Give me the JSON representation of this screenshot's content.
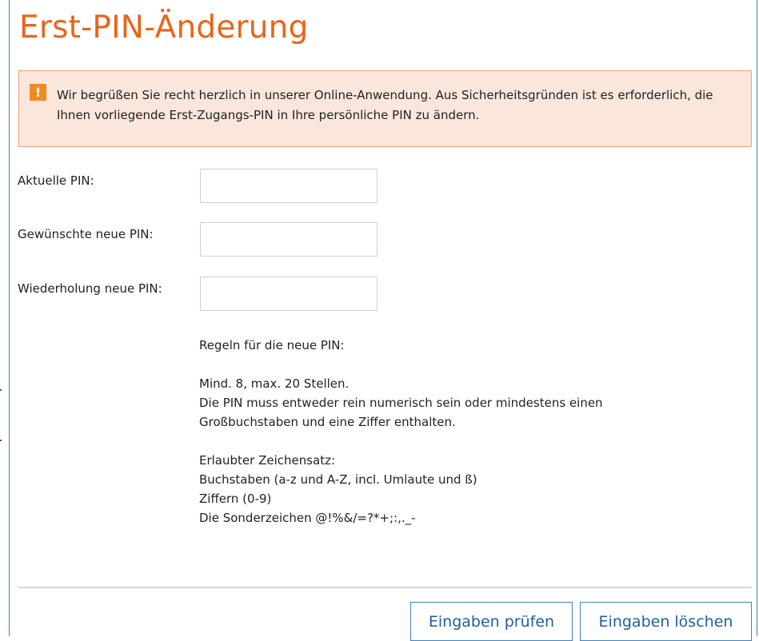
{
  "page": {
    "title": "Erst-PIN-Änderung"
  },
  "alert": {
    "icon": "exclamation-icon",
    "icon_glyph": "!",
    "text": "Wir begrüßen Sie recht herzlich in unserer Online-Anwendung. Aus Sicherheitsgründen ist es erforderlich, die Ihnen vorliegende Erst-Zugangs-PIN in Ihre persönliche PIN zu ändern."
  },
  "form": {
    "current_pin": {
      "label": "Aktuelle PIN:",
      "value": ""
    },
    "new_pin": {
      "label": "Gewünschte neue PIN:",
      "value": ""
    },
    "repeat_pin": {
      "label": "Wiederholung neue PIN:",
      "value": ""
    }
  },
  "rules": {
    "heading": "Regeln für die neue PIN:",
    "length": "Mind. 8, max. 20 Stellen.",
    "composition_1": "Die PIN muss entweder rein numerisch sein oder mindestens einen",
    "composition_2": "Großbuchstaben und eine Ziffer enthalten.",
    "charset_heading": "Erlaubter Zeichensatz:",
    "charset_letters": "Buchstaben (a-z und A-Z, incl. Umlaute und ß)",
    "charset_digits": "Ziffern (0-9)",
    "charset_special": "Die Sonderzeichen @!%&/=?*+;:,._-"
  },
  "buttons": {
    "check": "Eingaben prüfen",
    "clear": "Eingaben löschen"
  },
  "colors": {
    "title": "#e8651a",
    "alert_bg": "#fbe6dc",
    "alert_border": "#f0a27d",
    "alert_icon": "#f08a24",
    "button_border": "#3b82c4",
    "button_text": "#1f5f9e"
  }
}
